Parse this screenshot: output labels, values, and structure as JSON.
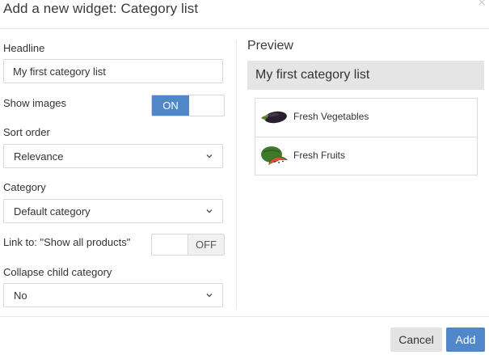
{
  "dialog": {
    "title": "Add a new widget: Category list"
  },
  "form": {
    "headline": {
      "label": "Headline",
      "value": "My first category list"
    },
    "show_images": {
      "label": "Show images",
      "on_label": "ON",
      "state": "on"
    },
    "sort_order": {
      "label": "Sort order",
      "value": "Relevance"
    },
    "category": {
      "label": "Category",
      "value": "Default category"
    },
    "link_to": {
      "label": "Link to: \"Show all products\"",
      "off_label": "OFF",
      "state": "off"
    },
    "collapse_child": {
      "label": "Collapse child category",
      "value": "No"
    }
  },
  "preview": {
    "label": "Preview",
    "headline": "My first category list",
    "items": [
      {
        "label": "Fresh Vegetables",
        "icon": "eggplant-icon"
      },
      {
        "label": "Fresh Fruits",
        "icon": "watermelon-icon"
      }
    ]
  },
  "footer": {
    "cancel_label": "Cancel",
    "add_label": "Add"
  },
  "colors": {
    "accent": "#4f87c9",
    "preview_header_bg": "#e5e5e5",
    "cancel_bg": "#e3e3e3"
  }
}
